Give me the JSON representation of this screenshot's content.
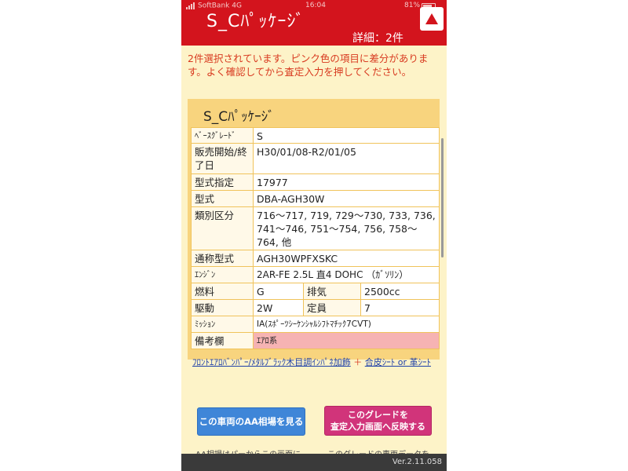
{
  "status_bar": {
    "carrier": "SoftBank 4G",
    "time": "16:04",
    "battery": "81%"
  },
  "header": {
    "title": "S_Cﾊﾟｯｹｰｼﾞ",
    "detail_count": "詳細：2件",
    "scroll_top_icon": "triangle-up-icon"
  },
  "notice": "2件選択されています。ピンク色の項目に差分があります。よく確認してから査定入力を押してください。",
  "card": {
    "title": "S_Cﾊﾟｯｹｰｼﾞ",
    "rows": {
      "base_grade": {
        "label": "ﾍﾞｰｽｸﾞﾚｰﾄﾞ",
        "value": "S"
      },
      "sales_period": {
        "label": "販売開始/終了日",
        "value": "H30/01/08-R2/01/05"
      },
      "model_designation": {
        "label": "型式指定",
        "value": "17977"
      },
      "model": {
        "label": "型式",
        "value": "DBA-AGH30W"
      },
      "category": {
        "label": "類別区分",
        "value": "716〜717, 719, 729〜730, 733, 736, 741〜746, 751〜754, 756, 758〜764, 他"
      },
      "common_model": {
        "label": "通称型式",
        "value": "AGH30WPFXSKC"
      },
      "engine": {
        "label": "ｴﾝｼﾞﾝ",
        "value": "2AR-FE 2.5L 直4 DOHC （ｶﾞｿﾘﾝ）"
      },
      "fuel": {
        "label": "燃料",
        "value": "G",
        "label2": "排気",
        "value2": "2500cc"
      },
      "drive": {
        "label": "駆動",
        "value": "2W",
        "label2": "定員",
        "value2": "7"
      },
      "mission": {
        "label": "ﾐｯｼｮﾝ",
        "value": "IA(ｽﾎﾟｰﾂｼｰｹﾝｼｬﾙｼﾌﾄﾏﾁｯｸ7CVT)"
      },
      "remarks": {
        "label": "備考欄",
        "value": "ｴｱﾛ系"
      }
    },
    "remarks_detail": {
      "part1": "ﾌﾛﾝﾄｴｱﾛﾊﾞﾝﾊﾟｰ/ﾒﾀﾙﾌﾞﾗｯｸ木目調ｲﾝﾊﾟﾈ加飾",
      "plus": "＋",
      "part2": "合皮ｼｰﾄ or 革ｼｰﾄ"
    }
  },
  "buttons": {
    "aa_market": "この車両のAA相場を見る",
    "reflect_line1": "このグレードを",
    "reflect_line2": "査定入力画面へ反映する"
  },
  "below_fold": {
    "left": "AA相場はパーからこの画面に",
    "right": "このグレードの車両データを"
  },
  "footer": {
    "version": "Ver.2.11.058"
  },
  "colors": {
    "header_red": "#d3141d",
    "background": "#fdf3c8",
    "card_yellow": "#f8d47e",
    "diff_pink": "#f6b3b3",
    "button_blue": "#3f86d8",
    "button_magenta": "#d1347a"
  }
}
